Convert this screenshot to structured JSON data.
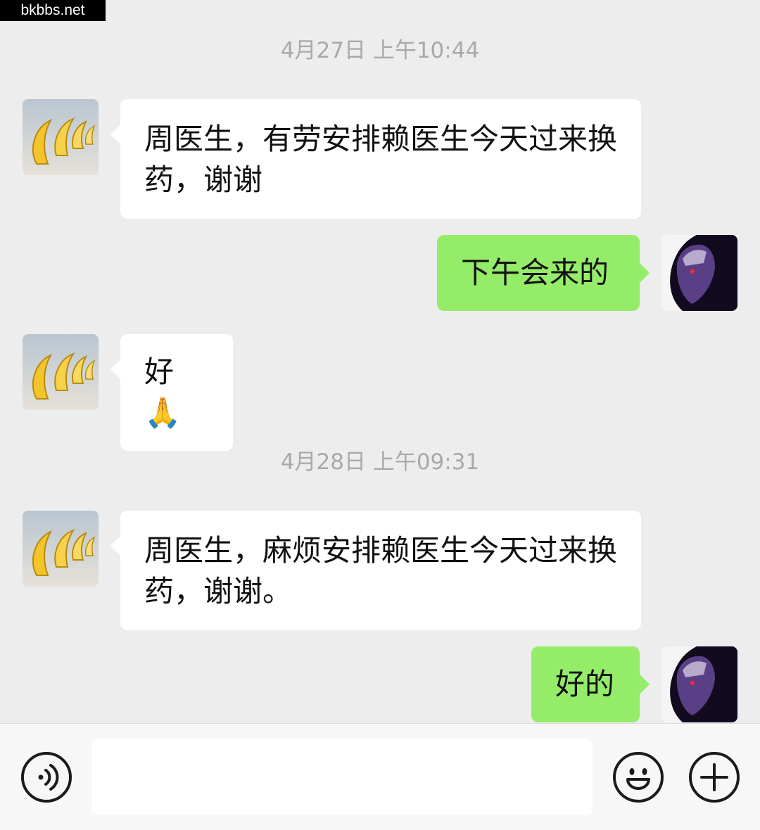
{
  "watermark": "bkbbs.net",
  "messages": [
    {
      "timestamp": "4月27日 上午10:44"
    },
    {
      "direction": "incoming",
      "text": "周医生，有劳安排赖医生今天过来换药，谢谢"
    },
    {
      "direction": "outgoing",
      "text": "下午会来的"
    },
    {
      "direction": "incoming",
      "text": "好🙏"
    },
    {
      "timestamp": "4月28日 上午09:31"
    },
    {
      "direction": "incoming",
      "text": "周医生，麻烦安排赖医生今天过来换药，谢谢。"
    },
    {
      "direction": "outgoing",
      "text": "好的"
    }
  ],
  "input_bar": {
    "voice_icon": "voice-icon",
    "emoji_icon": "emoji-icon",
    "plus_icon": "plus-icon",
    "message_value": ""
  },
  "colors": {
    "background": "#ededed",
    "incoming_bubble": "#ffffff",
    "outgoing_bubble": "#95ec69",
    "timestamp": "#a9a9a9"
  }
}
